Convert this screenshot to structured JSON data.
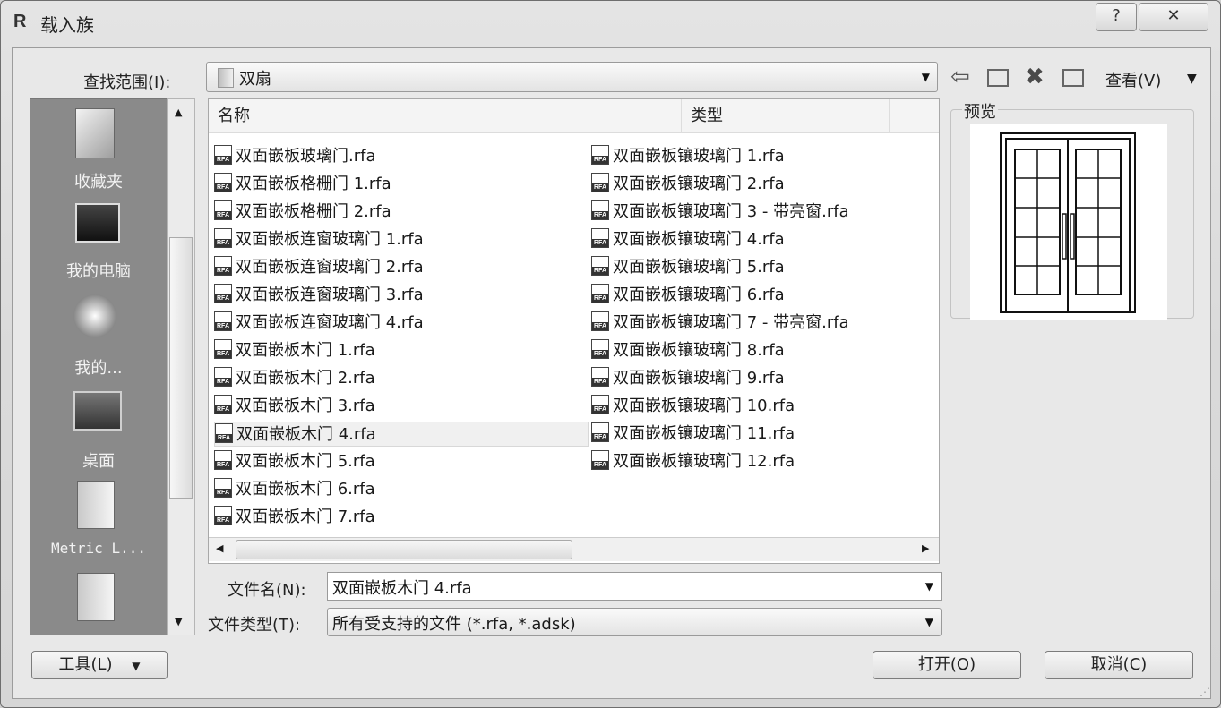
{
  "window": {
    "title": "载入族",
    "app_icon": "R",
    "help_glyph": "?",
    "close_glyph": "✕"
  },
  "lookin": {
    "label": "查找范围(I):",
    "value": "双扇"
  },
  "toolbar": {
    "view_label": "查看(V)"
  },
  "places": [
    {
      "icon": "favorites-icon",
      "label": "收藏夹"
    },
    {
      "icon": "my-computer-icon",
      "label": "我的电脑"
    },
    {
      "icon": "network-icon",
      "label": "我的..."
    },
    {
      "icon": "desktop-icon",
      "label": "桌面"
    },
    {
      "icon": "folder-icon",
      "label": "Metric L..."
    },
    {
      "icon": "folder-icon",
      "label": ""
    }
  ],
  "filelist": {
    "col_name": "名称",
    "col_type": "类型",
    "column1": [
      "双面嵌板玻璃门.rfa",
      "双面嵌板格栅门 1.rfa",
      "双面嵌板格栅门 2.rfa",
      "双面嵌板连窗玻璃门 1.rfa",
      "双面嵌板连窗玻璃门 2.rfa",
      "双面嵌板连窗玻璃门 3.rfa",
      "双面嵌板连窗玻璃门 4.rfa",
      "双面嵌板木门 1.rfa",
      "双面嵌板木门 2.rfa",
      "双面嵌板木门 3.rfa",
      "双面嵌板木门 4.rfa",
      "双面嵌板木门 5.rfa",
      "双面嵌板木门 6.rfa",
      "双面嵌板木门 7.rfa"
    ],
    "column2": [
      "双面嵌板镶玻璃门 1.rfa",
      "双面嵌板镶玻璃门 2.rfa",
      "双面嵌板镶玻璃门 3 - 带亮窗.rfa",
      "双面嵌板镶玻璃门 4.rfa",
      "双面嵌板镶玻璃门 5.rfa",
      "双面嵌板镶玻璃门 6.rfa",
      "双面嵌板镶玻璃门 7 - 带亮窗.rfa",
      "双面嵌板镶玻璃门 8.rfa",
      "双面嵌板镶玻璃门 9.rfa",
      "双面嵌板镶玻璃门 10.rfa",
      "双面嵌板镶玻璃门 11.rfa",
      "双面嵌板镶玻璃门 12.rfa"
    ],
    "selected": "双面嵌板木门 4.rfa"
  },
  "filename": {
    "label": "文件名(N):",
    "value": "双面嵌板木门 4.rfa"
  },
  "filetype": {
    "label": "文件类型(T):",
    "value": "所有受支持的文件 (*.rfa, *.adsk)"
  },
  "preview": {
    "label": "预览"
  },
  "buttons": {
    "tools": "工具(L)",
    "open": "打开(O)",
    "cancel": "取消(C)"
  }
}
